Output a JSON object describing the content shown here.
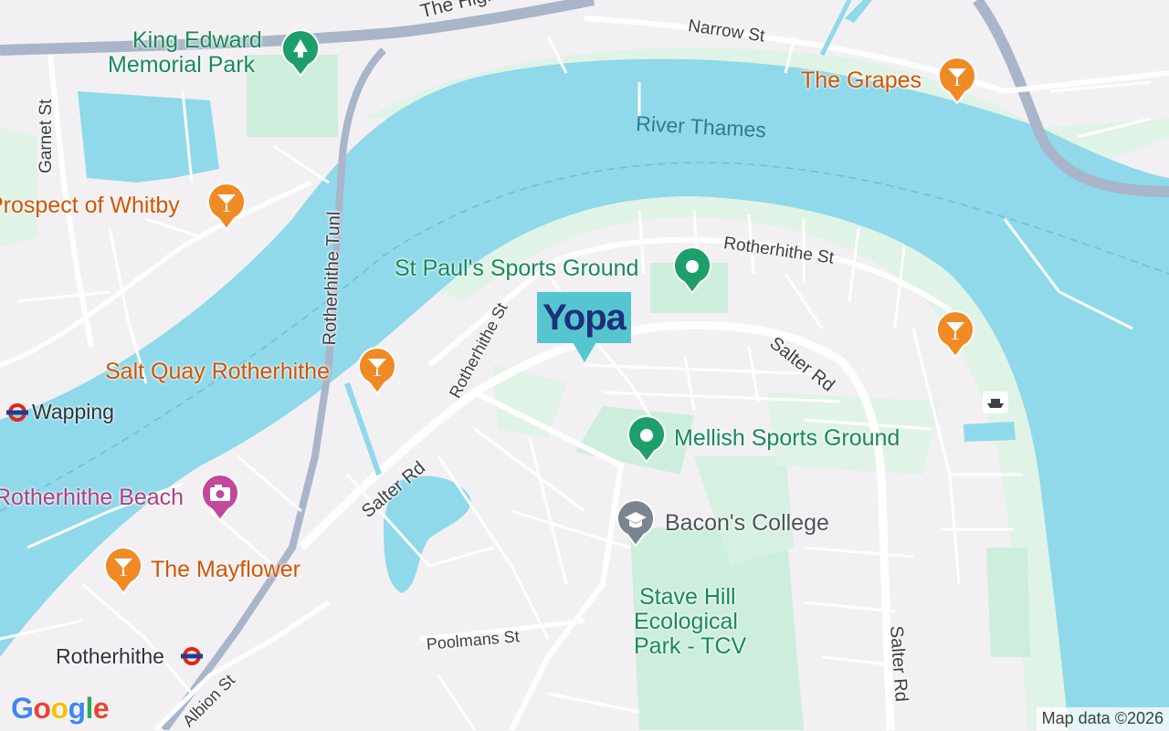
{
  "map": {
    "roads": {
      "the_highway": "The Highway",
      "narrow_st": "Narrow St",
      "garnet_st": "Garnet St",
      "rotherhithe_tunl": "Rotherhithe Tunl",
      "rotherhithe_st_west": "Rotherhithe St",
      "rotherhithe_st_north": "Rotherhithe St",
      "salter_rd_north": "Salter Rd",
      "salter_rd_west": "Salter Rd",
      "salter_rd_east": "Salter Rd",
      "poolmans_st": "Poolmans St",
      "albion_st": "Albion St"
    },
    "water": {
      "river": "River Thames"
    },
    "places": {
      "king_edward_line1": "King Edward",
      "king_edward_line2": "Memorial Park",
      "st_pauls": "St Paul's Sports Ground",
      "mellish": "Mellish Sports Ground",
      "stave_hill_line1": "Stave Hill",
      "stave_hill_line2": "Ecological",
      "stave_hill_line3": "Park - TCV",
      "bacons_college": "Bacon's College",
      "the_grapes": "The Grapes",
      "prospect_of_whitby": "Prospect of Whitby",
      "salt_quay": "Salt Quay Rotherhithe",
      "the_mayflower": "The Mayflower",
      "rotherhithe_beach": "Rotherhithe Beach",
      "wapping": "Wapping",
      "rotherhithe_station": "Rotherhithe"
    },
    "marker": {
      "brand": "Yopa",
      "color": "#55c6cf",
      "text_color": "#1f2f7a"
    },
    "colors": {
      "water": "#8fd9ea",
      "land": "#f2f0f3",
      "park": "#cdeedd",
      "road": "#ffffff",
      "highway": "#a9b5c9",
      "food_pin": "#f08a24",
      "park_pin": "#1e9e6a"
    }
  },
  "attribution": "Map data ©2026",
  "logo": {
    "text": "Google",
    "letters": [
      "G",
      "o",
      "o",
      "g",
      "l",
      "e"
    ],
    "colors": [
      "#4285f4",
      "#ea4335",
      "#fbbc05",
      "#4285f4",
      "#34a853",
      "#ea4335"
    ]
  }
}
